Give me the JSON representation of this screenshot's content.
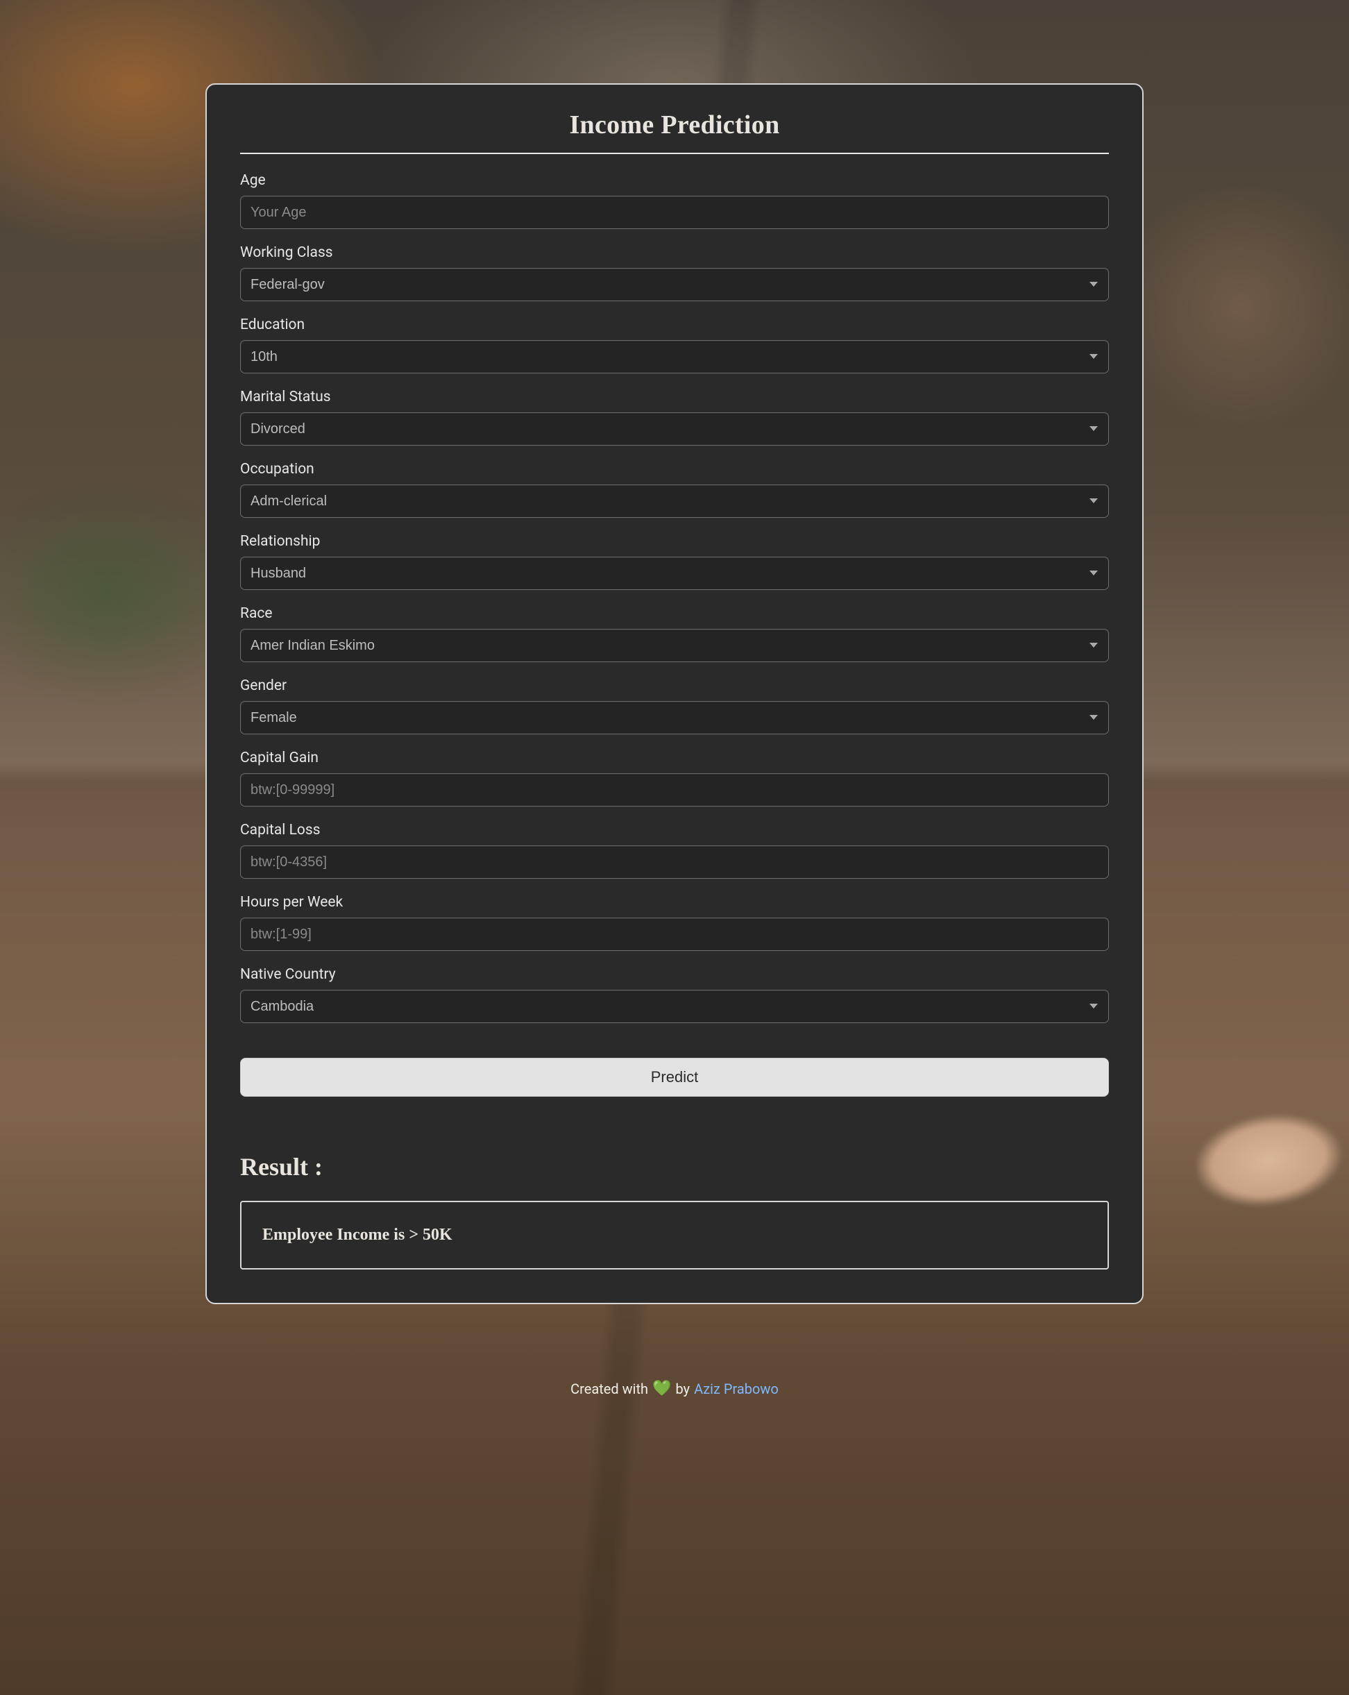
{
  "title": "Income Prediction",
  "fields": {
    "age": {
      "label": "Age",
      "type": "text",
      "placeholder": "Your Age"
    },
    "workclass": {
      "label": "Working Class",
      "type": "select",
      "value": "Federal-gov"
    },
    "education": {
      "label": "Education",
      "type": "select",
      "value": "10th"
    },
    "marital": {
      "label": "Marital Status",
      "type": "select",
      "value": "Divorced"
    },
    "occupation": {
      "label": "Occupation",
      "type": "select",
      "value": "Adm-clerical"
    },
    "relationship": {
      "label": "Relationship",
      "type": "select",
      "value": "Husband"
    },
    "race": {
      "label": "Race",
      "type": "select",
      "value": "Amer Indian Eskimo"
    },
    "gender": {
      "label": "Gender",
      "type": "select",
      "value": "Female"
    },
    "capgain": {
      "label": "Capital Gain",
      "type": "text",
      "placeholder": "btw:[0-99999]"
    },
    "caploss": {
      "label": "Capital Loss",
      "type": "text",
      "placeholder": "btw:[0-4356]"
    },
    "hours": {
      "label": "Hours per Week",
      "type": "text",
      "placeholder": "btw:[1-99]"
    },
    "country": {
      "label": "Native Country",
      "type": "select",
      "value": "Cambodia"
    }
  },
  "button": {
    "predict": "Predict"
  },
  "result": {
    "header": "Result :",
    "text": "Employee Income is > 50K"
  },
  "footer": {
    "prefix": "Created with",
    "by": "by",
    "author": "Aziz Prabowo"
  },
  "colors": {
    "card_bg": "#2a2a2a",
    "border": "#d7d7d7",
    "heart": "#1fd655"
  }
}
